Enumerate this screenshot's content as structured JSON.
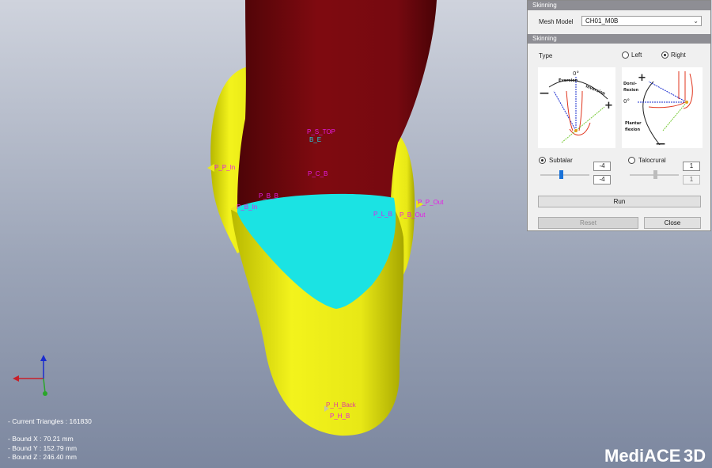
{
  "viewport": {
    "labels": {
      "p_s_top": "P_S_TOP",
      "b_e": "B_E",
      "p_c_b": "P_C_B",
      "p_p_in": "P_P_In",
      "p_b_b": "P_B_B",
      "p_b_in": "P_B_In",
      "p_p_out": "P_P_Out",
      "p_l_b": "P_L_B",
      "p_b_out": "P_B_Out",
      "p_h_back": "P_H_Back",
      "p_h_b": "P_H_B"
    },
    "info": {
      "triangles": "- Current Triangles : 161830",
      "bound_x": "- Bound X : 70.21 mm",
      "bound_y": "- Bound Y : 152.79 mm",
      "bound_z": "- Bound Z : 246.40 mm"
    },
    "logo": {
      "text_a": "Medi",
      "text_b": "ACE",
      "text_c": "3D"
    },
    "colors": {
      "leg": "#7a0a10",
      "foot": "#e6e61a",
      "skin": "#19e1e1"
    }
  },
  "panel": {
    "top_header": "Skinning",
    "mesh_model_label": "Mesh Model",
    "mesh_model_value": "CH01_M0B",
    "section_header": "Skinning",
    "type_label": "Type",
    "left_label": "Left",
    "right_label": "Right",
    "type_selected": "Right",
    "diagram1": {
      "deg": "0°",
      "eversion": "Eversion",
      "inversion": "Inversion",
      "minus": "—",
      "plus": "+"
    },
    "diagram2": {
      "dorsi": "Dorsi-",
      "flexion1": "flexion",
      "deg": "0°",
      "plantar": "Plantar",
      "flexion2": "flexion",
      "plus": "+",
      "minus": "—"
    },
    "subtalar": {
      "label": "Subtalar",
      "value_top": "-4",
      "value_bottom": "-4",
      "selected": true,
      "slider_fraction": 0.42
    },
    "talocrural": {
      "label": "Talocrural",
      "value_top": "1",
      "value_bottom": "1",
      "selected": false,
      "slider_fraction": 0.52
    },
    "run_label": "Run",
    "reset_label": "Reset",
    "close_label": "Close"
  }
}
